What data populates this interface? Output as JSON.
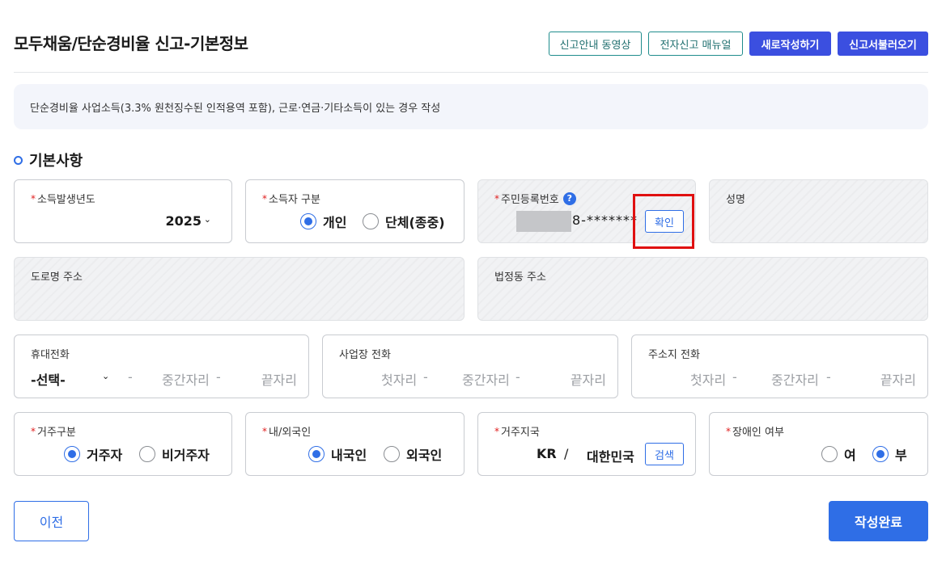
{
  "header": {
    "title": "모두채움/단순경비율 신고-기본정보",
    "buttons": [
      "신고안내 동영상",
      "전자신고 매뉴얼",
      "새로작성하기",
      "신고서불러오기"
    ]
  },
  "notice": "단순경비율 사업소득(3.3% 원천징수된 인적용역 포함), 근로·연금·기타소득이 있는 경우 작성",
  "section_title": "기본사항",
  "required_mark": "*",
  "fields": {
    "income_year": {
      "label": "소득발생년도",
      "value": "2025",
      "chevron": "⌄"
    },
    "earner_type": {
      "label": "소득자 구분",
      "options": [
        "개인",
        "단체(종중)"
      ],
      "selected": "개인"
    },
    "resident_no": {
      "label": "주민등록번호",
      "help": "?",
      "value": "8-*******",
      "button": "확인"
    },
    "name": {
      "label": "성명"
    },
    "road_address": {
      "label": "도로명 주소"
    },
    "lot_address": {
      "label": "법정동 주소"
    },
    "mobile": {
      "label": "휴대전화",
      "select": "-선택-",
      "chevron": "⌄",
      "dash": "-",
      "middle": "중간자리",
      "last": "끝자리"
    },
    "biz_phone": {
      "label": "사업장 전화",
      "first": "첫자리",
      "dash": "-",
      "middle": "중간자리",
      "last": "끝자리"
    },
    "home_phone": {
      "label": "주소지 전화",
      "first": "첫자리",
      "dash": "-",
      "middle": "중간자리",
      "last": "끝자리"
    },
    "residency": {
      "label": "거주구분",
      "options": [
        "거주자",
        "비거주자"
      ],
      "selected": "거주자"
    },
    "nationality": {
      "label": "내/외국인",
      "options": [
        "내국인",
        "외국인"
      ],
      "selected": "내국인"
    },
    "country": {
      "label": "거주지국",
      "code": "KR",
      "slash": "/",
      "name": "대한민국",
      "button": "검색"
    },
    "disability": {
      "label": "장애인 여부",
      "options": [
        "여",
        "부"
      ],
      "selected": "부"
    }
  },
  "footer": {
    "prev": "이전",
    "done": "작성완료"
  },
  "colors": {
    "primary": "#2f6ee6",
    "header_solid": "#3b4fe0",
    "outline_teal": "#1f8c8c",
    "required": "#e02020",
    "highlight": "#e01010"
  }
}
